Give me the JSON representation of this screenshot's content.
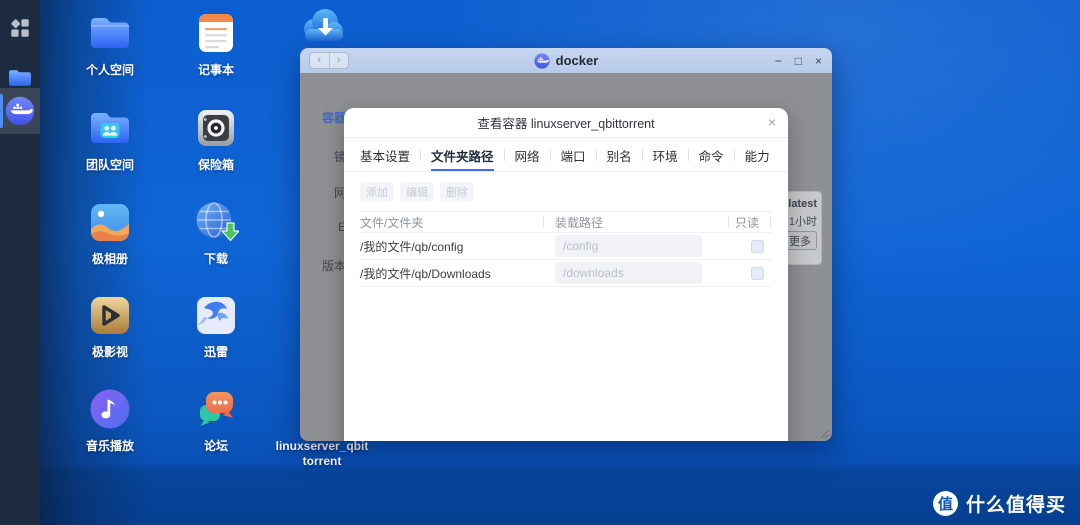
{
  "sidebar": {
    "items": [
      {
        "name": "apps-grid",
        "active": false
      },
      {
        "name": "file-manager",
        "active": false
      },
      {
        "name": "docker",
        "active": true
      }
    ]
  },
  "desktop": {
    "columns": [
      {
        "items": [
          {
            "label": "个人空间",
            "type": "folder-personal"
          },
          {
            "label": "团队空间",
            "type": "folder-team"
          },
          {
            "label": "极相册",
            "type": "photos"
          },
          {
            "label": "极影视",
            "type": "movies"
          },
          {
            "label": "音乐播放",
            "type": "music"
          }
        ]
      },
      {
        "items": [
          {
            "label": "记事本",
            "type": "notepad"
          },
          {
            "label": "保险箱",
            "type": "safe"
          },
          {
            "label": "下载",
            "type": "download-globe"
          },
          {
            "label": "迅雷",
            "type": "thunder"
          },
          {
            "label": "论坛",
            "type": "forum"
          }
        ]
      },
      {
        "items": [
          {
            "label": "",
            "type": "cloud-download"
          },
          {
            "label": "linuxserver_qbittorrent",
            "type": "qbittorrent"
          }
        ]
      }
    ],
    "watermark": {
      "badge": "值",
      "text": "什么值得买"
    }
  },
  "window": {
    "title": "docker",
    "nav_back": "‹",
    "nav_forward": "›",
    "controls": {
      "minimize": "−",
      "maximize": "□",
      "close": "×"
    },
    "bg_fragments": {
      "container_menu": "容器",
      "image_label": "镜",
      "network_label": "网",
      "entry_label": "E",
      "version_label": "版本"
    },
    "side_card": {
      "tag": ":latest",
      "age": "1小时",
      "more_button": "更多"
    }
  },
  "modal": {
    "title": "查看容器 linuxserver_qbittorrent",
    "close": "×",
    "tabs": [
      {
        "label": "基本设置",
        "active": false
      },
      {
        "label": "文件夹路径",
        "active": true
      },
      {
        "label": "网络",
        "active": false
      },
      {
        "label": "端口",
        "active": false
      },
      {
        "label": "别名",
        "active": false
      },
      {
        "label": "环境",
        "active": false
      },
      {
        "label": "命令",
        "active": false
      },
      {
        "label": "能力",
        "active": false
      }
    ],
    "toolbar": {
      "add": "添加",
      "edit": "编辑",
      "delete": "删除"
    },
    "table": {
      "columns": [
        "文件/文件夹",
        "装载路径",
        "只读"
      ],
      "rows": [
        {
          "path": "/我的文件/qb/config",
          "mount": "/config",
          "readonly": false
        },
        {
          "path": "/我的文件/qb/Downloads",
          "mount": "/downloads",
          "readonly": false
        }
      ]
    }
  }
}
